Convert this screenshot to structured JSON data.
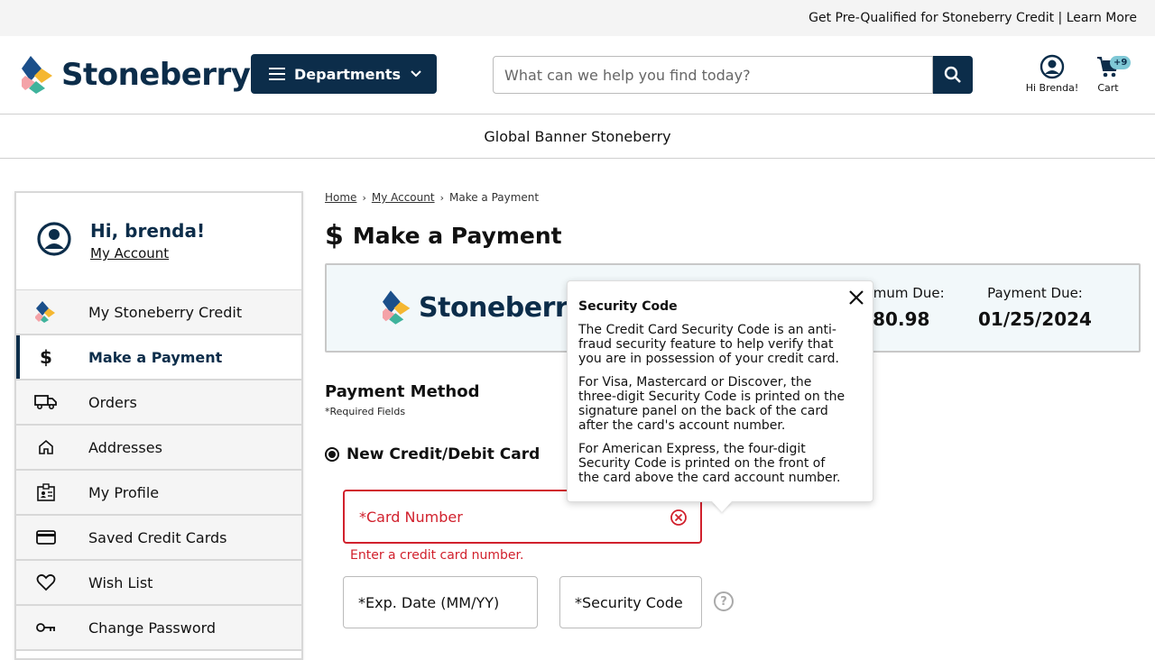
{
  "promo": {
    "text": "Get Pre-Qualified for Stoneberry Credit | Learn More"
  },
  "header": {
    "logo_text": "Stoneberry",
    "departments_label": "Departments",
    "search_placeholder": "What can we help you find today?",
    "account_label": "Hi Brenda!",
    "cart_label": "Cart",
    "cart_badge": "+9"
  },
  "banner": {
    "text": "Global Banner Stoneberry"
  },
  "sidebar": {
    "greeting": "Hi, brenda!",
    "account_link": "My Account",
    "items": [
      {
        "label": "My Stoneberry Credit",
        "icon": "stoneberry-logo-icon"
      },
      {
        "label": "Make a Payment",
        "icon": "dollar-icon",
        "active": true
      },
      {
        "label": "Orders",
        "icon": "truck-icon"
      },
      {
        "label": "Addresses",
        "icon": "home-icon"
      },
      {
        "label": "My Profile",
        "icon": "profile-card-icon"
      },
      {
        "label": "Saved Credit Cards",
        "icon": "credit-card-icon"
      },
      {
        "label": "Wish List",
        "icon": "heart-icon"
      },
      {
        "label": "Change Password",
        "icon": "key-icon"
      }
    ]
  },
  "breadcrumb": {
    "home": "Home",
    "account": "My Account",
    "current": "Make a Payment"
  },
  "page": {
    "title": "Make a Payment",
    "title_icon": "$"
  },
  "summary": {
    "logo_text": "Stoneberry",
    "min_due_label": "Minimum Due:",
    "min_due_value": "$80.98",
    "payment_due_label": "Payment Due:",
    "payment_due_value": "01/25/2024"
  },
  "payment": {
    "title": "Payment Method",
    "required_note": "*Required Fields",
    "option_label": "New Credit/Debit Card",
    "card_number_label": "*Card Number",
    "card_number_error": "Enter a credit card number.",
    "exp_label": "*Exp. Date (MM/YY)",
    "cvv_label": "*Security Code",
    "help_glyph": "?"
  },
  "tooltip": {
    "title": "Security Code",
    "p1": "The Credit Card Security Code is an anti-fraud security feature to help verify that you are in possession of your credit card.",
    "p2": "For Visa, Mastercard or Discover, the three-digit Security Code is printed on the signature panel on the back of the card after the card's account number.",
    "p3": "For American Express, the four-digit Security Code is printed on the front of the card above the card account number."
  },
  "colors": {
    "brand_navy": "#0c2d4a",
    "error_red": "#d1212d",
    "badge_teal": "#7fc8d6",
    "summary_bg": "#f2f8fa"
  }
}
